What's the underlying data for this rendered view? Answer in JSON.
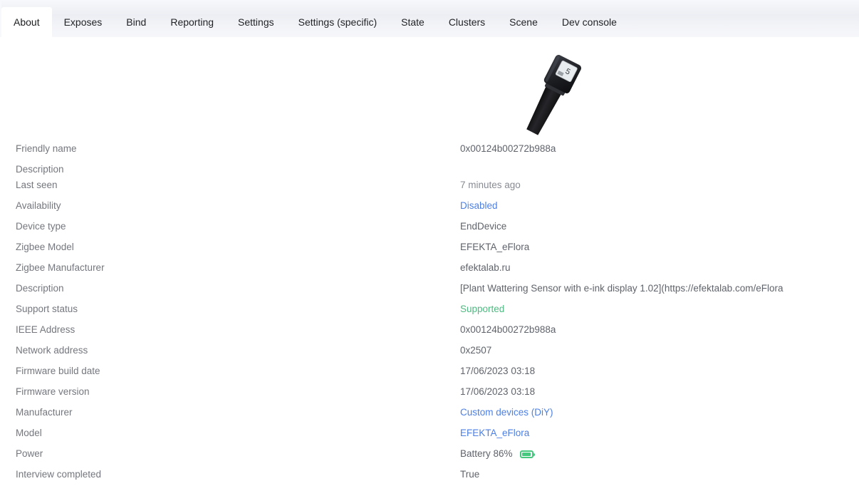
{
  "tabs": [
    {
      "label": "About",
      "active": true
    },
    {
      "label": "Exposes",
      "active": false
    },
    {
      "label": "Bind",
      "active": false
    },
    {
      "label": "Reporting",
      "active": false
    },
    {
      "label": "Settings",
      "active": false
    },
    {
      "label": "Settings (specific)",
      "active": false
    },
    {
      "label": "State",
      "active": false
    },
    {
      "label": "Clusters",
      "active": false
    },
    {
      "label": "Scene",
      "active": false
    },
    {
      "label": "Dev console",
      "active": false
    }
  ],
  "device_image": {
    "alt": "EFEKTA eFlora plant watering sensor with e-ink display"
  },
  "rows": [
    {
      "label": "Friendly name",
      "value": "0x00124b00272b988a",
      "style": "plain"
    },
    {
      "label": "Description",
      "value": "",
      "style": "plain",
      "tight": true
    },
    {
      "label": "Last seen",
      "value": "7 minutes ago",
      "style": "dim"
    },
    {
      "label": "Availability",
      "value": "Disabled",
      "style": "link"
    },
    {
      "label": "Device type",
      "value": "EndDevice",
      "style": "plain"
    },
    {
      "label": "Zigbee Model",
      "value": "EFEKTA_eFlora",
      "style": "plain"
    },
    {
      "label": "Zigbee Manufacturer",
      "value": "efektalab.ru",
      "style": "plain"
    },
    {
      "label": "Description",
      "value": "[Plant Wattering Sensor with e-ink display 1.02](https://efektalab.com/eFlora",
      "style": "plain"
    },
    {
      "label": "Support status",
      "value": "Supported",
      "style": "ok"
    },
    {
      "label": "IEEE Address",
      "value": "0x00124b00272b988a",
      "style": "plain"
    },
    {
      "label": "Network address",
      "value": "0x2507",
      "style": "plain"
    },
    {
      "label": "Firmware build date",
      "value": "17/06/2023 03:18",
      "style": "plain"
    },
    {
      "label": "Firmware version",
      "value": "17/06/2023 03:18",
      "style": "plain"
    },
    {
      "label": "Manufacturer",
      "value": "Custom devices (DiY)",
      "style": "link"
    },
    {
      "label": "Model",
      "value": "EFEKTA_eFlora",
      "style": "link"
    },
    {
      "label": "Power",
      "value": "Battery 86%",
      "style": "plain",
      "battery": true
    },
    {
      "label": "Interview completed",
      "value": "True",
      "style": "plain"
    }
  ],
  "colors": {
    "link": "#4c7fe4",
    "supported": "#4fb981",
    "battery": "#46c97f",
    "label": "#74777e",
    "value": "#5f636b",
    "tabstrip": "#eceef3"
  }
}
